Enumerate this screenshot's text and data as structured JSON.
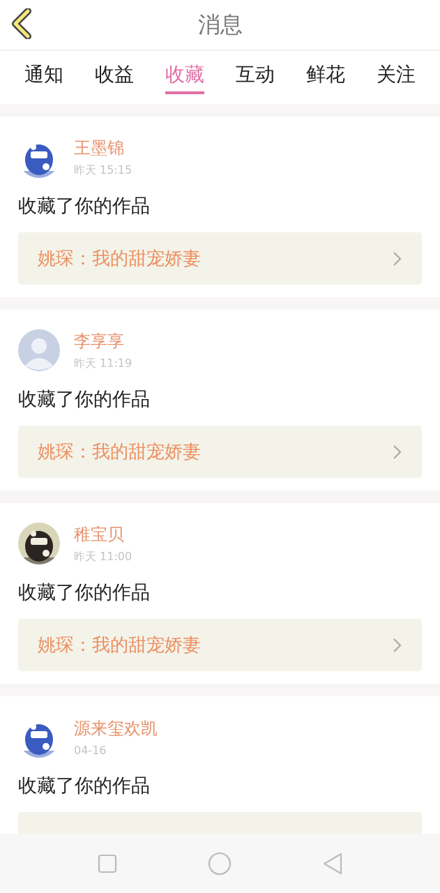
{
  "header": {
    "title": "消息"
  },
  "tabs": [
    {
      "label": "通知",
      "selected": false
    },
    {
      "label": "收益",
      "selected": false
    },
    {
      "label": "收藏",
      "selected": true
    },
    {
      "label": "互动",
      "selected": false
    },
    {
      "label": "鲜花",
      "selected": false
    },
    {
      "label": "关注",
      "selected": false
    }
  ],
  "messages": [
    {
      "name": "王墨锦",
      "time": "昨天 15:15",
      "text": "收藏了你的作品",
      "work": "姚琛：我的甜宠娇妻"
    },
    {
      "avatar": {
        "kind": "default"
      },
      "name": "李享享",
      "time": "昨天 11:19",
      "text": "收藏了你的作品",
      "work": "姚琛：我的甜宠娇妻"
    },
    {
      "name": "稚宝贝",
      "time": "昨天 11:00",
      "text": "收藏了你的作品",
      "work": "姚琛：我的甜宠娇妻"
    },
    {
      "name": "源来玺欢凯",
      "time": "04-16",
      "text": "收藏了你的作品"
    }
  ]
}
